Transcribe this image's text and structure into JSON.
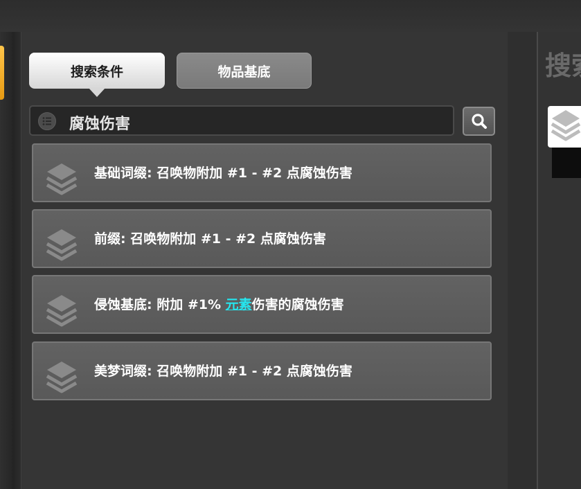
{
  "tabs": [
    {
      "label": "搜索条件",
      "active": true
    },
    {
      "label": "物品基底",
      "active": false
    }
  ],
  "search": {
    "value": "腐蚀伤害",
    "list_icon": "list-icon",
    "button_icon": "search-icon"
  },
  "results": [
    {
      "text": "基础词缀: 召唤物附加 #1 - #2 点腐蚀伤害",
      "icon": "layers-icon"
    },
    {
      "text": "前缀: 召唤物附加 #1 - #2 点腐蚀伤害",
      "icon": "layers-icon"
    },
    {
      "text_before": "侵蚀基底: 附加 #1% ",
      "highlight": "元素",
      "text_after": "伤害的腐蚀伤害",
      "icon": "layers-icon"
    },
    {
      "text": "美梦词缀: 召唤物附加 #1 - #2 点腐蚀伤害",
      "icon": "layers-icon"
    }
  ],
  "right_panel": {
    "title": "搜索",
    "thumbnail_icon": "layers-icon"
  },
  "colors": {
    "highlight": "#25e6ee",
    "accent_tab": "#f0a820",
    "panel_bg": "#353535",
    "item_bg": "#5e5e5e"
  }
}
